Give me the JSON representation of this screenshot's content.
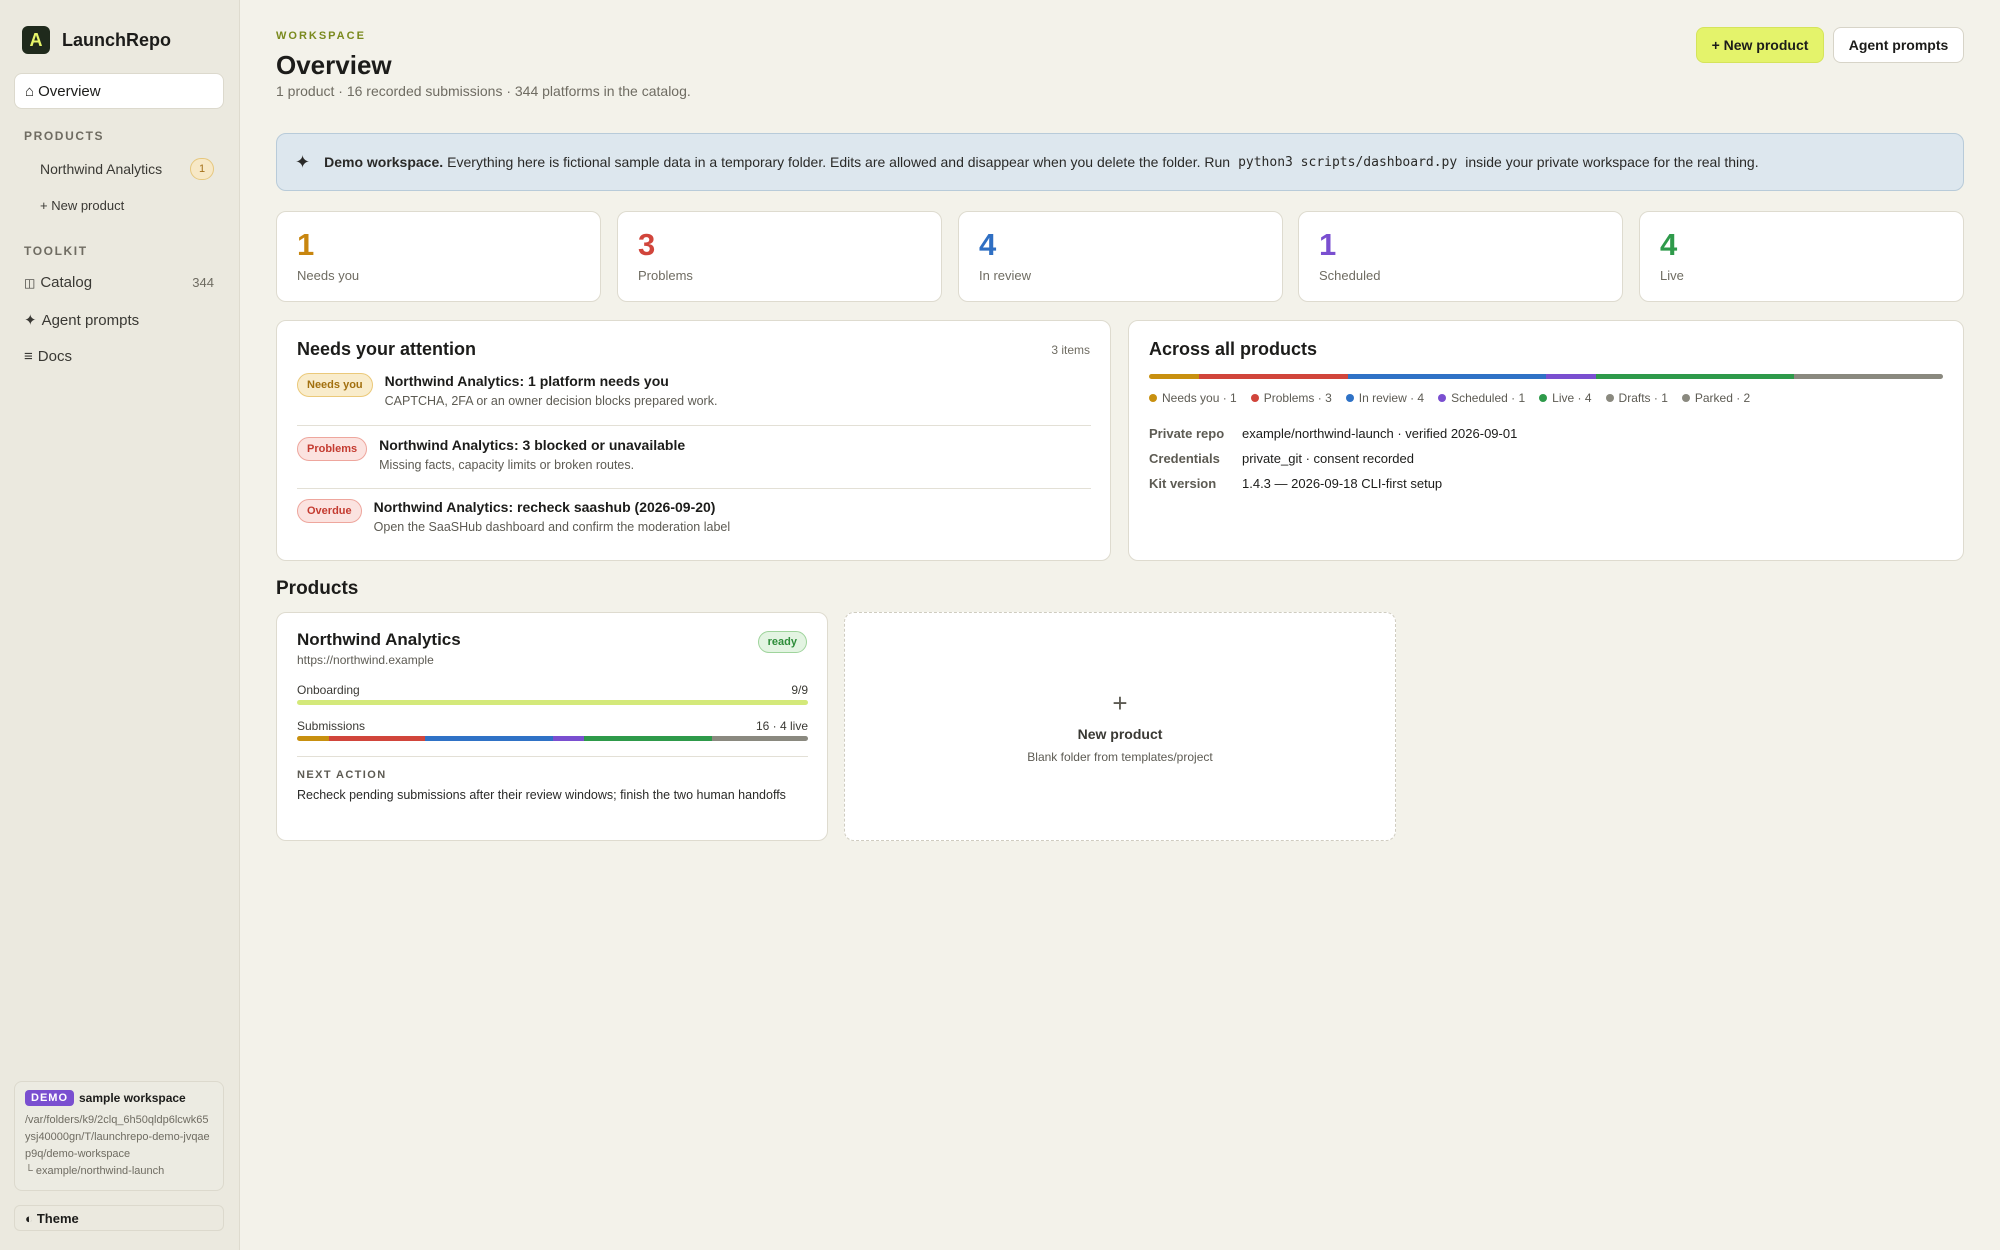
{
  "app": {
    "logo_letter": "A",
    "name": "LaunchRepo"
  },
  "sidebar": {
    "overview": {
      "icon": "⌂",
      "label": "Overview"
    },
    "products_label": "PRODUCTS",
    "products": [
      {
        "label": "Northwind Analytics",
        "badge": "1"
      }
    ],
    "new_product": "+ New product",
    "toolkit_label": "TOOLKIT",
    "toolkit": [
      {
        "icon": "◫",
        "label": "Catalog",
        "count": "344"
      },
      {
        "icon": "✦",
        "label": "Agent prompts"
      },
      {
        "icon": "≡",
        "label": "Docs"
      }
    ],
    "demo": {
      "tag": "DEMO",
      "title": "sample workspace",
      "path": "/var/folders/k9/2clq_6h50qldp6lcwk65ysj40000gn/T/launchrepo-demo-jvqaep9q/demo-workspace",
      "repo": "└ example/northwind-launch"
    },
    "theme": {
      "icon": "◐",
      "label": "Theme"
    }
  },
  "header": {
    "eyebrow": "WORKSPACE",
    "title": "Overview",
    "subtitle": "1 product · 16 recorded submissions · 344 platforms in the catalog.",
    "new_product_button": "+ New product",
    "agent_prompts_button": "Agent prompts"
  },
  "banner": {
    "icon": "✦",
    "bold": "Demo workspace.",
    "text": "Everything here is fictional sample data in a temporary folder. Edits are allowed and disappear when you delete the folder. Run",
    "code": "python3 scripts/dashboard.py",
    "tail": "inside your private workspace for the real thing."
  },
  "stats": [
    {
      "value": "1",
      "label": "Needs you",
      "color": "#c8860f"
    },
    {
      "value": "3",
      "label": "Problems",
      "color": "#d1453b"
    },
    {
      "value": "4",
      "label": "In review",
      "color": "#2f6fc3"
    },
    {
      "value": "1",
      "label": "Scheduled",
      "color": "#7a4fd0"
    },
    {
      "value": "4",
      "label": "Live",
      "color": "#2e9a4a"
    }
  ],
  "attention": {
    "title": "Needs your attention",
    "count": "3 items",
    "items": [
      {
        "tag": "Needs you",
        "title": "Northwind Analytics: 1 platform needs you",
        "desc": "CAPTCHA, 2FA or an owner decision blocks prepared work."
      },
      {
        "tag": "Problems",
        "title": "Northwind Analytics: 3 blocked or unavailable",
        "desc": "Missing facts, capacity limits or broken routes."
      },
      {
        "tag": "Overdue",
        "title": "Northwind Analytics: recheck saashub (2026-09-20)",
        "desc": "Open the SaaSHub dashboard and confirm the moderation label"
      }
    ]
  },
  "across": {
    "title": "Across all products",
    "segments": [
      {
        "label": "Needs you · 1",
        "value": 1,
        "color": "#c8900f"
      },
      {
        "label": "Problems · 3",
        "value": 3,
        "color": "#d1453b"
      },
      {
        "label": "In review · 4",
        "value": 4,
        "color": "#2f72c6"
      },
      {
        "label": "Scheduled · 1",
        "value": 1,
        "color": "#7a4fd0"
      },
      {
        "label": "Live · 4",
        "value": 4,
        "color": "#2e9a4a"
      },
      {
        "label": "Drafts · 1",
        "value": 1,
        "color": "#8a897f"
      },
      {
        "label": "Parked · 2",
        "value": 2,
        "color": "#8a897f"
      }
    ],
    "details": [
      {
        "key": "Private repo",
        "value": "example/northwind-launch · verified 2026-09-01"
      },
      {
        "key": "Credentials",
        "value": "private_git · consent recorded"
      },
      {
        "key": "Kit version",
        "value": "1.4.3 — 2026-09-18 CLI-first setup"
      }
    ]
  },
  "products": {
    "title": "Products",
    "card": {
      "name": "Northwind Analytics",
      "url": "https://northwind.example",
      "status": "ready",
      "onboarding_label": "Onboarding",
      "onboarding_value": "9/9",
      "onboarding_fraction": 1.0,
      "submissions_label": "Submissions",
      "submissions_value": "16 · 4 live",
      "next_action_label": "NEXT ACTION",
      "next_action": "Recheck pending submissions after their review windows; finish the two human handoffs"
    },
    "new_card": {
      "icon": "+",
      "title": "New product",
      "subtitle": "Blank folder from templates/project"
    }
  },
  "colors": {
    "accent": "#e4f36b",
    "onboarding_bar": "#d4e97a"
  }
}
